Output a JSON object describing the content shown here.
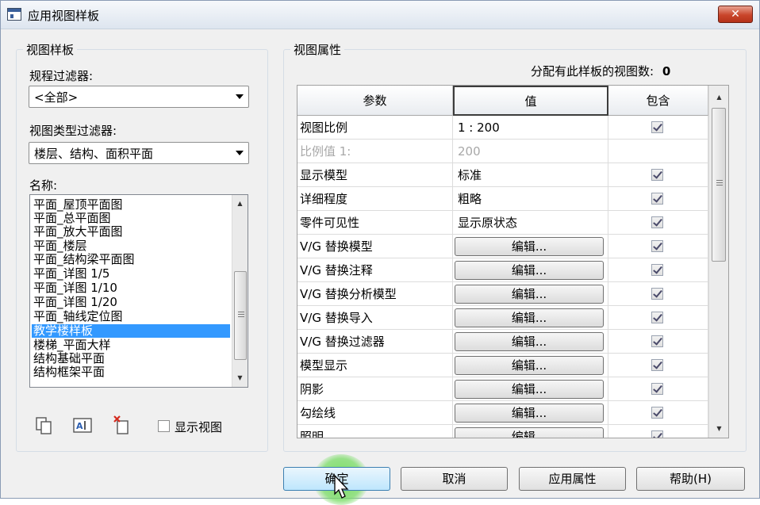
{
  "window": {
    "title": "应用视图样板",
    "close_icon": "close-icon"
  },
  "left": {
    "group_title": "视图样板",
    "discipline_label": "规程过滤器:",
    "discipline_value": "<全部>",
    "viewtype_label": "视图类型过滤器:",
    "viewtype_value": "楼层、结构、面积平面",
    "names_label": "名称:",
    "names": [
      "平面_屋顶平面图",
      "平面_总平面图",
      "平面_放大平面图",
      "平面_楼层",
      "平面_结构梁平面图",
      "平面_详图 1/5",
      "平面_详图 1/10",
      "平面_详图 1/20",
      "平面_轴线定位图",
      "教学楼样板",
      "楼梯_平面大样",
      "结构基础平面",
      "结构框架平面"
    ],
    "selected_index": 9,
    "tools": [
      "duplicate-icon",
      "rename-icon",
      "delete-icon"
    ],
    "show_views_label": "显示视图",
    "show_views_checked": false
  },
  "right": {
    "group_title": "视图属性",
    "assigned_label": "分配有此样板的视图数:",
    "assigned_count": "0",
    "headers": {
      "param": "参数",
      "value": "值",
      "include": "包含"
    },
    "rows": [
      {
        "param": "视图比例",
        "value": "1 : 200",
        "type": "text",
        "include": true,
        "disabled": false
      },
      {
        "param": "比例值 1:",
        "value": "200",
        "type": "text",
        "include": null,
        "disabled": true
      },
      {
        "param": "显示模型",
        "value": "标准",
        "type": "text",
        "include": true,
        "disabled": false
      },
      {
        "param": "详细程度",
        "value": "粗略",
        "type": "text",
        "include": true,
        "disabled": false
      },
      {
        "param": "零件可见性",
        "value": "显示原状态",
        "type": "text",
        "include": true,
        "disabled": false
      },
      {
        "param": "V/G 替换模型",
        "value": "编辑...",
        "type": "button",
        "include": true,
        "disabled": false
      },
      {
        "param": "V/G 替换注释",
        "value": "编辑...",
        "type": "button",
        "include": true,
        "disabled": false
      },
      {
        "param": "V/G 替换分析模型",
        "value": "编辑...",
        "type": "button",
        "include": true,
        "disabled": false
      },
      {
        "param": "V/G 替换导入",
        "value": "编辑...",
        "type": "button",
        "include": true,
        "disabled": false
      },
      {
        "param": "V/G 替换过滤器",
        "value": "编辑...",
        "type": "button",
        "include": true,
        "disabled": false
      },
      {
        "param": "模型显示",
        "value": "编辑...",
        "type": "button",
        "include": true,
        "disabled": false
      },
      {
        "param": "阴影",
        "value": "编辑...",
        "type": "button",
        "include": true,
        "disabled": false
      },
      {
        "param": "勾绘线",
        "value": "编辑...",
        "type": "button",
        "include": true,
        "disabled": false
      },
      {
        "param": "照明",
        "value": "编辑...",
        "type": "button",
        "include": true,
        "disabled": false
      }
    ]
  },
  "buttons": {
    "ok": "确定",
    "cancel": "取消",
    "apply": "应用属性",
    "help": "帮助(H)"
  }
}
